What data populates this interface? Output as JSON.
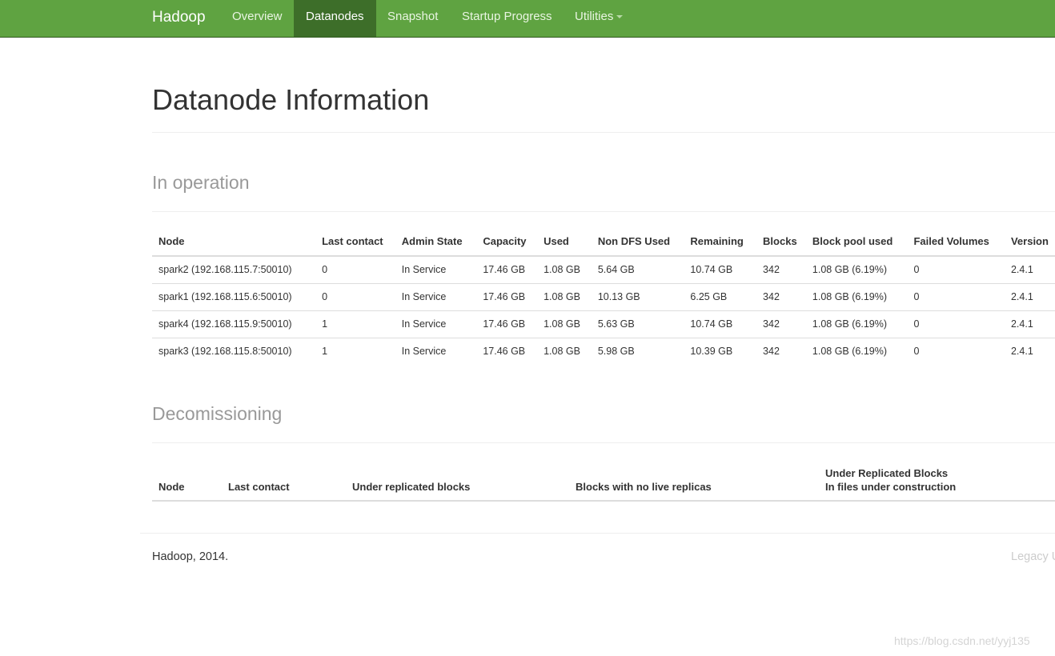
{
  "navbar": {
    "brand": "Hadoop",
    "items": [
      {
        "label": "Overview",
        "active": false
      },
      {
        "label": "Datanodes",
        "active": true
      },
      {
        "label": "Snapshot",
        "active": false
      },
      {
        "label": "Startup Progress",
        "active": false
      },
      {
        "label": "Utilities",
        "active": false,
        "dropdown": true
      }
    ],
    "colors": {
      "background": "#5fa341",
      "active_background": "#3d6e29"
    }
  },
  "page": {
    "title": "Datanode Information"
  },
  "in_operation": {
    "title": "In operation",
    "columns": [
      "Node",
      "Last contact",
      "Admin State",
      "Capacity",
      "Used",
      "Non DFS Used",
      "Remaining",
      "Blocks",
      "Block pool used",
      "Failed Volumes",
      "Version"
    ],
    "rows": [
      [
        "spark2 (192.168.115.7:50010)",
        "0",
        "In Service",
        "17.46 GB",
        "1.08 GB",
        "5.64 GB",
        "10.74 GB",
        "342",
        "1.08 GB (6.19%)",
        "0",
        "2.4.1"
      ],
      [
        "spark1 (192.168.115.6:50010)",
        "0",
        "In Service",
        "17.46 GB",
        "1.08 GB",
        "10.13 GB",
        "6.25 GB",
        "342",
        "1.08 GB (6.19%)",
        "0",
        "2.4.1"
      ],
      [
        "spark4 (192.168.115.9:50010)",
        "1",
        "In Service",
        "17.46 GB",
        "1.08 GB",
        "5.63 GB",
        "10.74 GB",
        "342",
        "1.08 GB (6.19%)",
        "0",
        "2.4.1"
      ],
      [
        "spark3 (192.168.115.8:50010)",
        "1",
        "In Service",
        "17.46 GB",
        "1.08 GB",
        "5.98 GB",
        "10.39 GB",
        "342",
        "1.08 GB (6.19%)",
        "0",
        "2.4.1"
      ]
    ]
  },
  "decommissioning": {
    "title": "Decomissioning",
    "columns": [
      "Node",
      "Last contact",
      "Under replicated blocks",
      "Blocks with no live replicas"
    ],
    "last_column": {
      "line1": "Under Replicated Blocks",
      "line2": "In files under construction"
    }
  },
  "footer": {
    "left": "Hadoop, 2014.",
    "right": "Legacy U"
  },
  "watermark": "https://blog.csdn.net/yyj135"
}
